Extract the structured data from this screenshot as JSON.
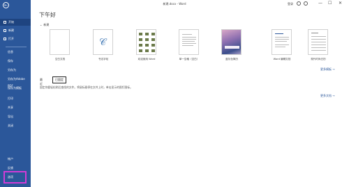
{
  "window": {
    "title": "新建.docx - Word",
    "signin": "登录",
    "minimize": "—",
    "maximize": "☐",
    "close": "✕"
  },
  "sidebar": {
    "back_glyph": "←",
    "items": [
      {
        "label": "开始"
      },
      {
        "label": "新建"
      },
      {
        "label": "打开"
      },
      {
        "label": "信息"
      },
      {
        "label": "保存"
      },
      {
        "label": "另存为"
      },
      {
        "label": "另存为Adobe PDF"
      },
      {
        "label": "保存为模板"
      },
      {
        "label": "打印"
      },
      {
        "label": "共享"
      },
      {
        "label": "导出"
      },
      {
        "label": "关闭"
      },
      {
        "label": "帐户"
      },
      {
        "label": "反馈"
      },
      {
        "label": "选项"
      }
    ]
  },
  "main": {
    "greeting": "下午好",
    "new_section": "新建",
    "templates": [
      {
        "caption": "空白文档"
      },
      {
        "caption": "书法字帖"
      },
      {
        "caption": "欢迎使用 Word"
      },
      {
        "caption": "单一空格（空白）"
      },
      {
        "caption": "蓝灰色简历"
      },
      {
        "caption": "Word 编辑文档"
      },
      {
        "caption": "现代时尚日历"
      }
    ],
    "more_templates": "更多模板 →",
    "tabs": {
      "recent": "最近",
      "pinned": "已固定"
    },
    "info_text": "固定你要轻松稍后查找的文件。将鼠标悬停在文件上时，单击显示的图钉图标。",
    "more_documents": "更多文档 →"
  },
  "colors": {
    "sidebar_bg": "#2b579a",
    "highlight_box": "#d23bd6",
    "accent": "#2b579a"
  }
}
